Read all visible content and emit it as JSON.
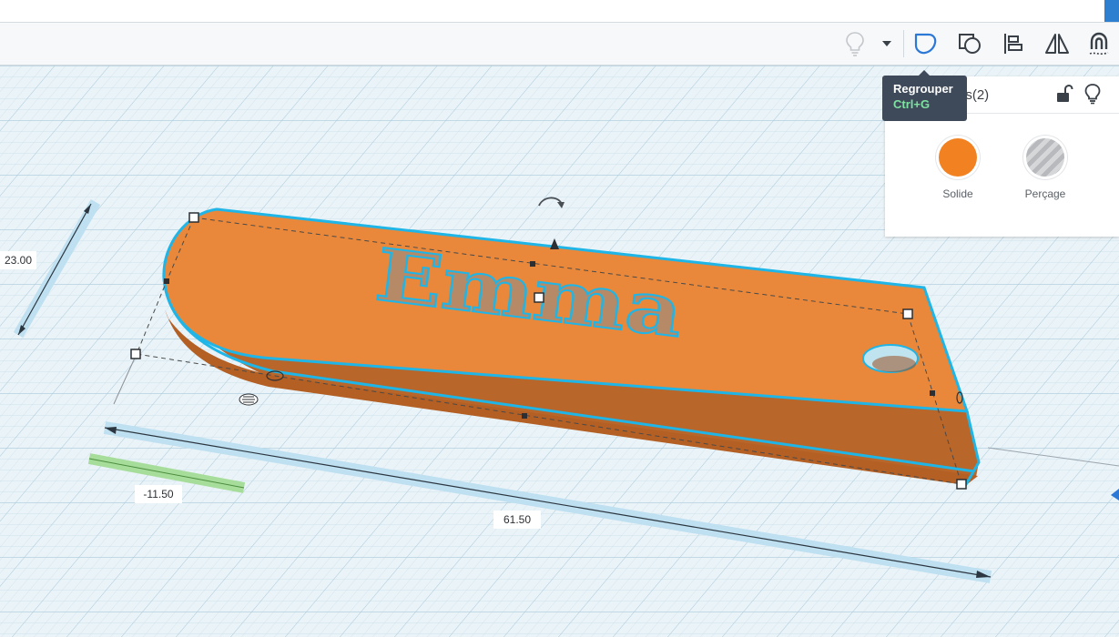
{
  "toolbar": {
    "buttons": [
      {
        "name": "bulb-icon"
      },
      {
        "name": "chevron-down-icon"
      },
      {
        "name": "group-icon"
      },
      {
        "name": "ungroup-icon"
      },
      {
        "name": "align-icon"
      },
      {
        "name": "mirror-icon"
      },
      {
        "name": "magnet-icon"
      }
    ]
  },
  "tooltip": {
    "title": "Regrouper",
    "shortcut": "Ctrl+G"
  },
  "inspector": {
    "title": "es(2)",
    "solid_label": "Solide",
    "hole_label": "Perçage",
    "solid_color": "#f28121"
  },
  "model": {
    "text": "Emma",
    "color": "#e9883a"
  },
  "dimensions": {
    "depth": "23.00",
    "offset": "-11.50",
    "length": "61.50"
  }
}
